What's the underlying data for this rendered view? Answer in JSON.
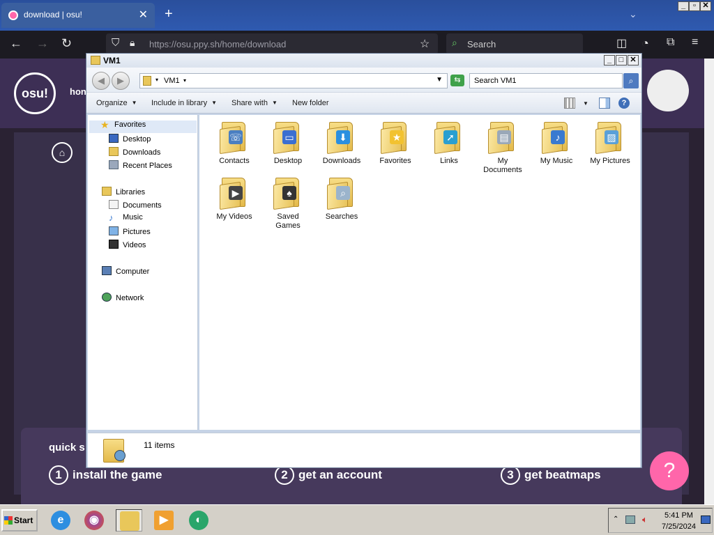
{
  "browser": {
    "tab_title": "download | osu!",
    "tab_close": "✕",
    "new_tab": "+",
    "url": "https://osu.ppy.sh/home/download",
    "search_placeholder": "Search"
  },
  "osu_page": {
    "logo_text": "osu!",
    "nav_home": "hon",
    "quick_title": "quick s",
    "steps": [
      {
        "num": "1",
        "label": "install the game"
      },
      {
        "num": "2",
        "label": "get an account"
      },
      {
        "num": "3",
        "label": "get beatmaps"
      }
    ],
    "help_label": "?"
  },
  "explorer": {
    "title": "VM1",
    "address": "VM1",
    "search_placeholder": "Search VM1",
    "commands": {
      "organize": "Organize",
      "include_in_library": "Include in library",
      "share_with": "Share with",
      "new_folder": "New folder"
    },
    "nav": {
      "favorites": "Favorites",
      "desktop": "Desktop",
      "downloads": "Downloads",
      "recent_places": "Recent Places",
      "libraries": "Libraries",
      "documents": "Documents",
      "music": "Music",
      "pictures": "Pictures",
      "videos": "Videos",
      "computer": "Computer",
      "network": "Network"
    },
    "folders": [
      {
        "label": "Contacts",
        "icon": "contacts-icon",
        "badge_color": "#4a7fc1"
      },
      {
        "label": "Desktop",
        "icon": "desktop-icon",
        "badge_color": "#3b6fd1"
      },
      {
        "label": "Downloads",
        "icon": "downloads-icon",
        "badge_color": "#2b8fe0"
      },
      {
        "label": "Favorites",
        "icon": "favorites-icon",
        "badge_color": "#f2c230"
      },
      {
        "label": "Links",
        "icon": "links-icon",
        "badge_color": "#2a9fd0"
      },
      {
        "label": "My\nDocuments",
        "icon": "documents-icon",
        "badge_color": "#9aa8b8"
      },
      {
        "label": "My Music",
        "icon": "music-icon",
        "badge_color": "#3a7ad0"
      },
      {
        "label": "My Pictures",
        "icon": "pictures-icon",
        "badge_color": "#5aa0d8"
      },
      {
        "label": "My Videos",
        "icon": "videos-icon",
        "badge_color": "#444444"
      },
      {
        "label": "Saved\nGames",
        "icon": "saved-games-icon",
        "badge_color": "#333333"
      },
      {
        "label": "Searches",
        "icon": "searches-icon",
        "badge_color": "#9bb4cc"
      }
    ],
    "status": "11 items"
  },
  "taskbar": {
    "start_label": "Start",
    "clock_time": "5:41 PM",
    "clock_date": "7/25/2024"
  }
}
